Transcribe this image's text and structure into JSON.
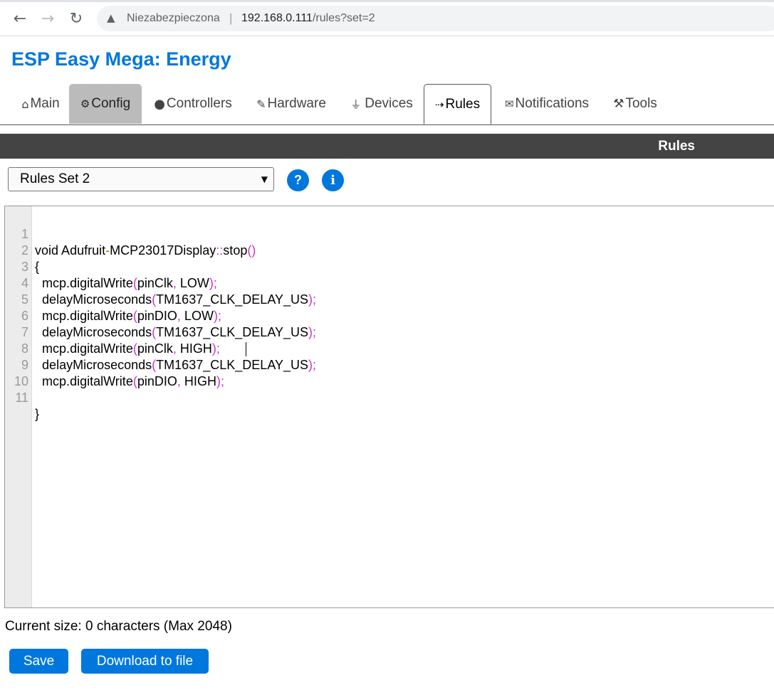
{
  "browser": {
    "security_label": "Niezabezpieczona",
    "url_host": "192.168.0.111",
    "url_path": "/rules?set=2"
  },
  "app": {
    "title": "ESP Easy Mega: Energy"
  },
  "tabs": [
    {
      "icon": "⌂",
      "label": "Main"
    },
    {
      "icon": "⚙",
      "label": "Config"
    },
    {
      "icon": "💬",
      "label": "Controllers"
    },
    {
      "icon": "📌",
      "label": "Hardware"
    },
    {
      "icon": "🔌",
      "label": "Devices"
    },
    {
      "icon": "⇢",
      "label": "Rules"
    },
    {
      "icon": "✉",
      "label": "Notifications"
    },
    {
      "icon": "🔧",
      "label": "Tools"
    }
  ],
  "section": {
    "title": "Rules"
  },
  "rules_select": {
    "selected": "Rules Set 2"
  },
  "help_buttons": {
    "help": "?",
    "info": "i"
  },
  "editor": {
    "lines": [
      {
        "num": "1",
        "text": "void Adufruit-MCP23017Display::stop()"
      },
      {
        "num": "2",
        "text": "{"
      },
      {
        "num": "3",
        "text": "  mcp.digitalWrite(pinClk, LOW);"
      },
      {
        "num": "4",
        "text": "  delayMicroseconds(TM1637_CLK_DELAY_US);"
      },
      {
        "num": "5",
        "text": "  mcp.digitalWrite(pinDIO, LOW);"
      },
      {
        "num": "6",
        "text": "  delayMicroseconds(TM1637_CLK_DELAY_US);"
      },
      {
        "num": "7",
        "text": "  mcp.digitalWrite(pinClk, HIGH);"
      },
      {
        "num": "8",
        "text": "  delayMicroseconds(TM1637_CLK_DELAY_US);"
      },
      {
        "num": "9",
        "text": "  mcp.digitalWrite(pinDIO, HIGH);"
      },
      {
        "num": "10",
        "text": ""
      },
      {
        "num": "11",
        "text": "}"
      }
    ]
  },
  "size_info": "Current size: 0 characters (Max 2048)",
  "buttons": {
    "save": "Save",
    "download": "Download to file"
  }
}
